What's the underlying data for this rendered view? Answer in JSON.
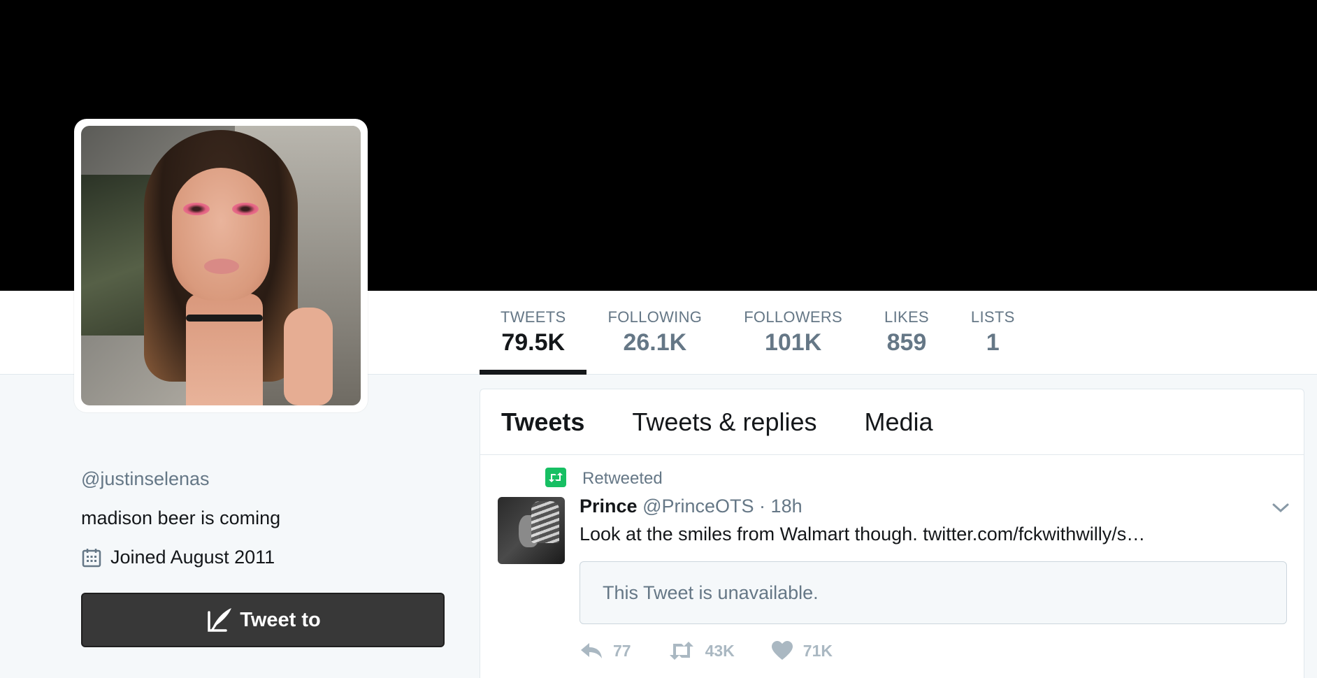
{
  "profile": {
    "handle": "@justinselenas",
    "bio": "madison beer is coming",
    "joined": "Joined August 2011",
    "tweet_to_label": "Tweet to"
  },
  "stats": [
    {
      "label": "TWEETS",
      "value": "79.5K",
      "active": true
    },
    {
      "label": "FOLLOWING",
      "value": "26.1K",
      "active": false
    },
    {
      "label": "FOLLOWERS",
      "value": "101K",
      "active": false
    },
    {
      "label": "LIKES",
      "value": "859",
      "active": false
    },
    {
      "label": "LISTS",
      "value": "1",
      "active": false
    }
  ],
  "tabs": [
    {
      "label": "Tweets",
      "active": true
    },
    {
      "label": "Tweets & replies",
      "active": false
    },
    {
      "label": "Media",
      "active": false
    }
  ],
  "tweet": {
    "retweet_label": "Retweeted",
    "name": "Prince",
    "screen_name": "@PrinceOTS",
    "separator": "·",
    "time": "18h",
    "text": "Look at the smiles from Walmart though. twitter.com/fckwithwilly/s…",
    "quote_text": "This Tweet is unavailable.",
    "actions": {
      "reply_count": "77",
      "retweet_count": "43K",
      "like_count": "71K"
    }
  },
  "colors": {
    "banner": "#000000",
    "page_bg": "#f5f8fa",
    "text_primary": "#14171a",
    "text_secondary": "#657786",
    "retweet_green": "#17bf63",
    "action_gray": "#aab8c2",
    "tweet_to_bg": "#383838"
  }
}
